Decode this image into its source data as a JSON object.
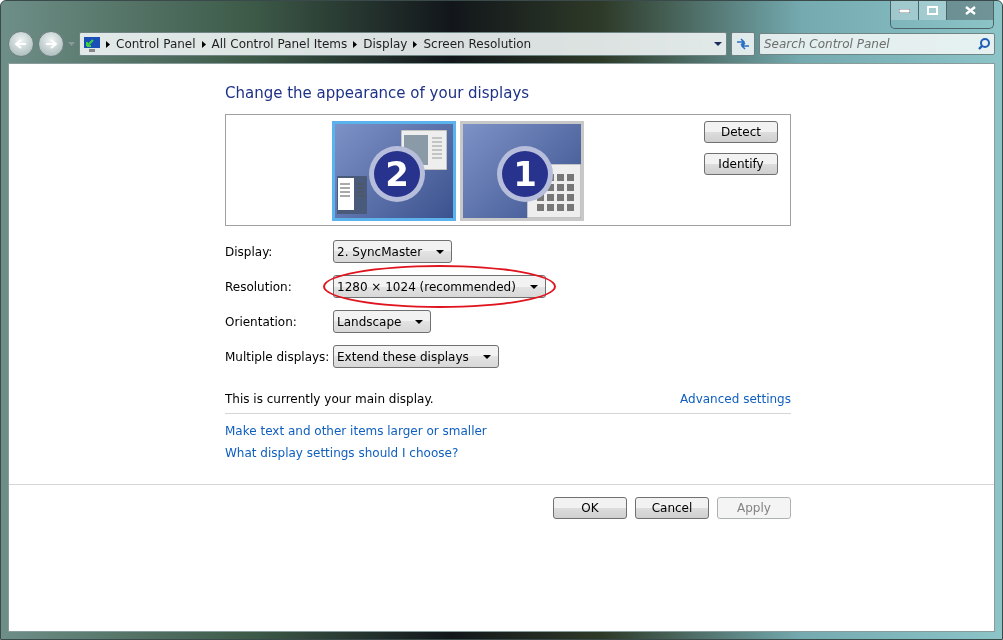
{
  "breadcrumbs": [
    "Control Panel",
    "All Control Panel Items",
    "Display",
    "Screen Resolution"
  ],
  "search": {
    "placeholder": "Search Control Panel"
  },
  "heading": "Change the appearance of your displays",
  "monitors": [
    {
      "number": "2",
      "selected": true
    },
    {
      "number": "1",
      "selected": false
    }
  ],
  "monitor_buttons": [
    "Detect",
    "Identify"
  ],
  "settings": [
    {
      "label": "Display:",
      "value": "2. SyncMaster",
      "highlighted": false
    },
    {
      "label": "Resolution:",
      "value": "1280 × 1024 (recommended)",
      "highlighted": true
    },
    {
      "label": "Orientation:",
      "value": "Landscape",
      "highlighted": false
    },
    {
      "label": "Multiple displays:",
      "value": "Extend these displays",
      "highlighted": false
    }
  ],
  "main_display_note": "This is currently your main display.",
  "advanced_link": "Advanced settings",
  "links": [
    "Make text and other items larger or smaller",
    "What display settings should I choose?"
  ],
  "buttons": [
    {
      "label": "OK",
      "disabled": false
    },
    {
      "label": "Cancel",
      "disabled": false
    },
    {
      "label": "Apply",
      "disabled": true
    }
  ]
}
